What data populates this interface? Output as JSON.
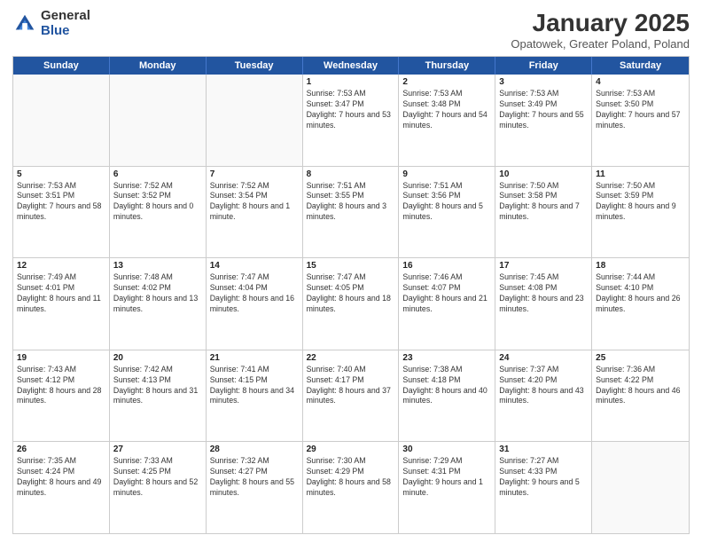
{
  "logo": {
    "general": "General",
    "blue": "Blue"
  },
  "title": {
    "month": "January 2025",
    "location": "Opatowek, Greater Poland, Poland"
  },
  "header": {
    "days": [
      "Sunday",
      "Monday",
      "Tuesday",
      "Wednesday",
      "Thursday",
      "Friday",
      "Saturday"
    ]
  },
  "rows": [
    [
      {
        "day": "",
        "text": "",
        "empty": true
      },
      {
        "day": "",
        "text": "",
        "empty": true
      },
      {
        "day": "",
        "text": "",
        "empty": true
      },
      {
        "day": "1",
        "text": "Sunrise: 7:53 AM\nSunset: 3:47 PM\nDaylight: 7 hours and 53 minutes."
      },
      {
        "day": "2",
        "text": "Sunrise: 7:53 AM\nSunset: 3:48 PM\nDaylight: 7 hours and 54 minutes."
      },
      {
        "day": "3",
        "text": "Sunrise: 7:53 AM\nSunset: 3:49 PM\nDaylight: 7 hours and 55 minutes."
      },
      {
        "day": "4",
        "text": "Sunrise: 7:53 AM\nSunset: 3:50 PM\nDaylight: 7 hours and 57 minutes."
      }
    ],
    [
      {
        "day": "5",
        "text": "Sunrise: 7:53 AM\nSunset: 3:51 PM\nDaylight: 7 hours and 58 minutes."
      },
      {
        "day": "6",
        "text": "Sunrise: 7:52 AM\nSunset: 3:52 PM\nDaylight: 8 hours and 0 minutes."
      },
      {
        "day": "7",
        "text": "Sunrise: 7:52 AM\nSunset: 3:54 PM\nDaylight: 8 hours and 1 minute."
      },
      {
        "day": "8",
        "text": "Sunrise: 7:51 AM\nSunset: 3:55 PM\nDaylight: 8 hours and 3 minutes."
      },
      {
        "day": "9",
        "text": "Sunrise: 7:51 AM\nSunset: 3:56 PM\nDaylight: 8 hours and 5 minutes."
      },
      {
        "day": "10",
        "text": "Sunrise: 7:50 AM\nSunset: 3:58 PM\nDaylight: 8 hours and 7 minutes."
      },
      {
        "day": "11",
        "text": "Sunrise: 7:50 AM\nSunset: 3:59 PM\nDaylight: 8 hours and 9 minutes."
      }
    ],
    [
      {
        "day": "12",
        "text": "Sunrise: 7:49 AM\nSunset: 4:01 PM\nDaylight: 8 hours and 11 minutes."
      },
      {
        "day": "13",
        "text": "Sunrise: 7:48 AM\nSunset: 4:02 PM\nDaylight: 8 hours and 13 minutes."
      },
      {
        "day": "14",
        "text": "Sunrise: 7:47 AM\nSunset: 4:04 PM\nDaylight: 8 hours and 16 minutes."
      },
      {
        "day": "15",
        "text": "Sunrise: 7:47 AM\nSunset: 4:05 PM\nDaylight: 8 hours and 18 minutes."
      },
      {
        "day": "16",
        "text": "Sunrise: 7:46 AM\nSunset: 4:07 PM\nDaylight: 8 hours and 21 minutes."
      },
      {
        "day": "17",
        "text": "Sunrise: 7:45 AM\nSunset: 4:08 PM\nDaylight: 8 hours and 23 minutes."
      },
      {
        "day": "18",
        "text": "Sunrise: 7:44 AM\nSunset: 4:10 PM\nDaylight: 8 hours and 26 minutes."
      }
    ],
    [
      {
        "day": "19",
        "text": "Sunrise: 7:43 AM\nSunset: 4:12 PM\nDaylight: 8 hours and 28 minutes."
      },
      {
        "day": "20",
        "text": "Sunrise: 7:42 AM\nSunset: 4:13 PM\nDaylight: 8 hours and 31 minutes."
      },
      {
        "day": "21",
        "text": "Sunrise: 7:41 AM\nSunset: 4:15 PM\nDaylight: 8 hours and 34 minutes."
      },
      {
        "day": "22",
        "text": "Sunrise: 7:40 AM\nSunset: 4:17 PM\nDaylight: 8 hours and 37 minutes."
      },
      {
        "day": "23",
        "text": "Sunrise: 7:38 AM\nSunset: 4:18 PM\nDaylight: 8 hours and 40 minutes."
      },
      {
        "day": "24",
        "text": "Sunrise: 7:37 AM\nSunset: 4:20 PM\nDaylight: 8 hours and 43 minutes."
      },
      {
        "day": "25",
        "text": "Sunrise: 7:36 AM\nSunset: 4:22 PM\nDaylight: 8 hours and 46 minutes."
      }
    ],
    [
      {
        "day": "26",
        "text": "Sunrise: 7:35 AM\nSunset: 4:24 PM\nDaylight: 8 hours and 49 minutes."
      },
      {
        "day": "27",
        "text": "Sunrise: 7:33 AM\nSunset: 4:25 PM\nDaylight: 8 hours and 52 minutes."
      },
      {
        "day": "28",
        "text": "Sunrise: 7:32 AM\nSunset: 4:27 PM\nDaylight: 8 hours and 55 minutes."
      },
      {
        "day": "29",
        "text": "Sunrise: 7:30 AM\nSunset: 4:29 PM\nDaylight: 8 hours and 58 minutes."
      },
      {
        "day": "30",
        "text": "Sunrise: 7:29 AM\nSunset: 4:31 PM\nDaylight: 9 hours and 1 minute."
      },
      {
        "day": "31",
        "text": "Sunrise: 7:27 AM\nSunset: 4:33 PM\nDaylight: 9 hours and 5 minutes."
      },
      {
        "day": "",
        "text": "",
        "empty": true
      }
    ]
  ]
}
